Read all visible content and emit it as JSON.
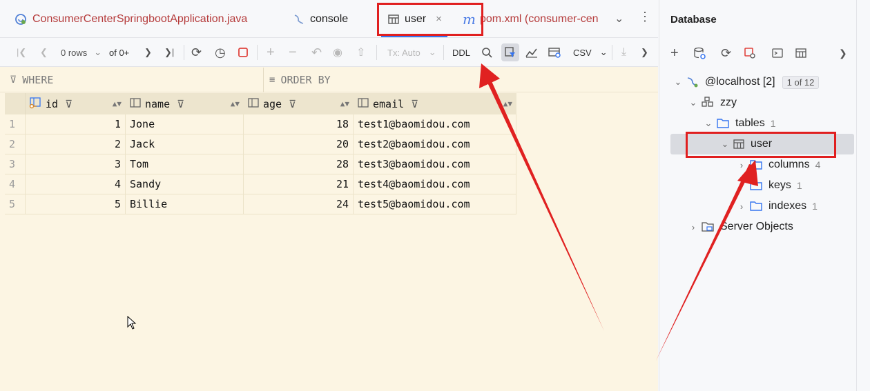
{
  "tabs": [
    {
      "label": "ConsumerCenterSpringbootApplication.java",
      "icon": "spring-boot-icon"
    },
    {
      "label": "console",
      "icon": "console-icon"
    },
    {
      "label": "user",
      "icon": "table-icon",
      "close": "×"
    },
    {
      "label": "pom.xml (consumer-cen",
      "icon": "maven-icon",
      "icon_text": "m"
    }
  ],
  "toolbar": {
    "rows": "0 rows",
    "of": "of 0+",
    "tx": "Tx: Auto",
    "ddl": "DDL",
    "csv": "CSV"
  },
  "filter": {
    "where": "WHERE",
    "order_by": "ORDER BY"
  },
  "table": {
    "columns": [
      "id",
      "name",
      "age",
      "email"
    ],
    "rows": [
      {
        "n": "1",
        "id": "1",
        "name": "Jone",
        "age": "18",
        "email": "test1@baomidou.com"
      },
      {
        "n": "2",
        "id": "2",
        "name": "Jack",
        "age": "20",
        "email": "test2@baomidou.com"
      },
      {
        "n": "3",
        "id": "3",
        "name": "Tom",
        "age": "28",
        "email": "test3@baomidou.com"
      },
      {
        "n": "4",
        "id": "4",
        "name": "Sandy",
        "age": "21",
        "email": "test4@baomidou.com"
      },
      {
        "n": "5",
        "id": "5",
        "name": "Billie",
        "age": "24",
        "email": "test5@baomidou.com"
      }
    ]
  },
  "database": {
    "title": "Database",
    "tree": {
      "host": "@localhost [2]",
      "host_badge": "1 of 12",
      "schema": "zzy",
      "tables": "tables",
      "tables_count": "1",
      "user": "user",
      "columns": "columns",
      "columns_count": "4",
      "keys": "keys",
      "keys_count": "1",
      "indexes": "indexes",
      "indexes_count": "1",
      "server_objects": "Server Objects"
    }
  },
  "colors": {
    "accent": "#3574f0",
    "annotation": "#e01f1f",
    "grid_bg": "#fcf5e3"
  }
}
